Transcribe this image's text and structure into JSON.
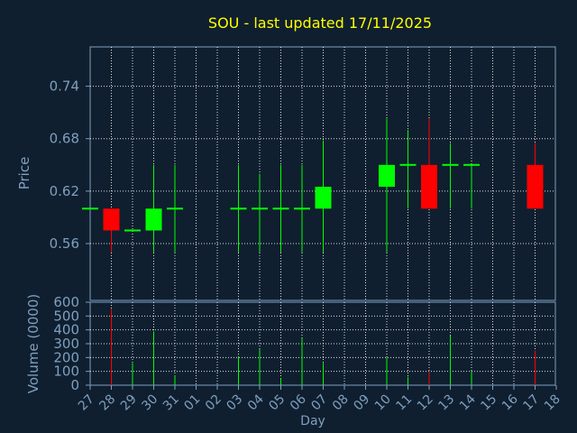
{
  "chart_data": {
    "type": "candlestick",
    "title": "SOU - last updated 17/11/2025",
    "xlabel": "Day",
    "price_ylabel": "Price",
    "volume_ylabel": "Volume (0000)",
    "grid": true,
    "price_ylim": [
      0.495,
      0.785
    ],
    "price_ticks": [
      "0.74",
      "0.68",
      "0.62",
      "0.56"
    ],
    "volume_ylim": [
      0,
      600
    ],
    "volume_ticks": [
      "600",
      "500",
      "400",
      "300",
      "200",
      "100",
      "0"
    ],
    "x_ticks": [
      "27",
      "28",
      "29",
      "30",
      "31",
      "01",
      "02",
      "03",
      "04",
      "05",
      "06",
      "07",
      "08",
      "09",
      "10",
      "11",
      "12",
      "13",
      "14",
      "15",
      "16",
      "17",
      "18"
    ],
    "days": [
      {
        "day": "27",
        "open": 0.6,
        "high": 0.6,
        "low": 0.6,
        "close": 0.6,
        "volume": 0
      },
      {
        "day": "28",
        "open": 0.6,
        "high": 0.6,
        "low": 0.55,
        "close": 0.575,
        "volume": 550
      },
      {
        "day": "29",
        "open": 0.575,
        "high": 0.575,
        "low": 0.575,
        "close": 0.575,
        "volume": 160
      },
      {
        "day": "30",
        "open": 0.575,
        "high": 0.65,
        "low": 0.55,
        "close": 0.6,
        "volume": 390
      },
      {
        "day": "31",
        "open": 0.6,
        "high": 0.65,
        "low": 0.55,
        "close": 0.6,
        "volume": 70
      },
      {
        "day": "03",
        "open": 0.6,
        "high": 0.65,
        "low": 0.55,
        "close": 0.6,
        "volume": 210
      },
      {
        "day": "04",
        "open": 0.6,
        "high": 0.64,
        "low": 0.55,
        "close": 0.6,
        "volume": 260
      },
      {
        "day": "05",
        "open": 0.6,
        "high": 0.65,
        "low": 0.55,
        "close": 0.6,
        "volume": 50
      },
      {
        "day": "06",
        "open": 0.6,
        "high": 0.65,
        "low": 0.55,
        "close": 0.6,
        "volume": 340
      },
      {
        "day": "07",
        "open": 0.6,
        "high": 0.678,
        "low": 0.55,
        "close": 0.625,
        "volume": 160
      },
      {
        "day": "10",
        "open": 0.625,
        "high": 0.703,
        "low": 0.55,
        "close": 0.65,
        "volume": 200
      },
      {
        "day": "11",
        "open": 0.65,
        "high": 0.69,
        "low": 0.6,
        "close": 0.65,
        "volume": 60
      },
      {
        "day": "12",
        "open": 0.65,
        "high": 0.703,
        "low": 0.6,
        "close": 0.6,
        "volume": 100
      },
      {
        "day": "13",
        "open": 0.65,
        "high": 0.675,
        "low": 0.6,
        "close": 0.65,
        "volume": 360
      },
      {
        "day": "14",
        "open": 0.65,
        "high": 0.65,
        "low": 0.6,
        "close": 0.65,
        "volume": 100
      },
      {
        "day": "17",
        "open": 0.65,
        "high": 0.675,
        "low": 0.6,
        "close": 0.6,
        "volume": 250
      }
    ],
    "colors": {
      "background": "#0f1f2f",
      "axis": "#7f9fbf",
      "grid": "#ffffff",
      "title": "#ffff00",
      "up": "#00ff00",
      "down": "#ff0000"
    }
  }
}
